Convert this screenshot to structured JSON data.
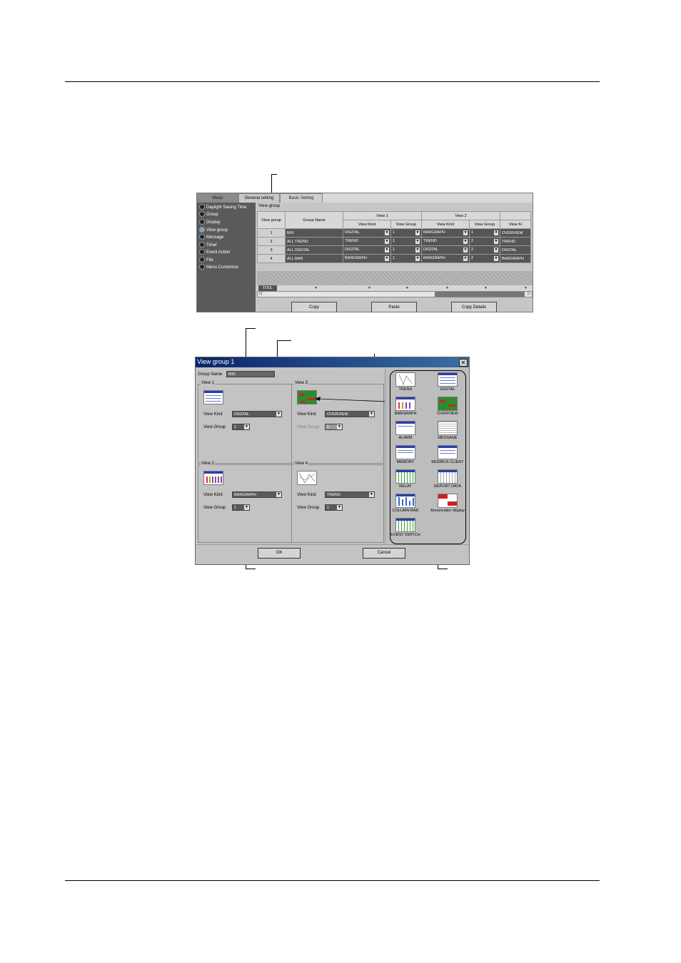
{
  "top_panel": {
    "tabs": [
      "Meas",
      "General setting",
      "Basic Setting"
    ],
    "side_items": [
      "Daylight Saving Time",
      "Group",
      "Display",
      "View group",
      "Message",
      "Timer",
      "Event Action",
      "File",
      "Menu Customize"
    ],
    "selected_side_item": "View group",
    "section_label": "View group",
    "headers": {
      "view_group": "View group",
      "group_name": "Group Name",
      "view1": "View 1",
      "view2": "View 2",
      "view_kind": "View Kind",
      "view_group_col": "View Group",
      "view_kind_cut": "View Ki"
    },
    "rows": [
      {
        "num": "1",
        "name": "MIX",
        "v1_kind": "DIGITAL",
        "v1_group": "1",
        "v2_kind": "BARGRAPH",
        "v2_group": "1",
        "v3_kind": "OVERVIEW"
      },
      {
        "num": "2",
        "name": "ALL TREND",
        "v1_kind": "TREND",
        "v1_group": "1",
        "v2_kind": "TREND",
        "v2_group": "2",
        "v3_kind": "TREND"
      },
      {
        "num": "3",
        "name": "ALL DIGITAL",
        "v1_kind": "DIGITAL",
        "v1_group": "1",
        "v2_kind": "DIGITAL",
        "v2_group": "2",
        "v3_kind": "DIGITAL"
      },
      {
        "num": "4",
        "name": "ALL BAR",
        "v1_kind": "BARGRAPH",
        "v1_group": "1",
        "v2_kind": "BARGRAPH",
        "v2_group": "2",
        "v3_kind": "BARGRAPH"
      }
    ],
    "tool_label": "TOOL",
    "buttons": {
      "copy": "Copy",
      "paste": "Paste",
      "copy_details": "Copy Details"
    }
  },
  "dialog": {
    "title": "View group 1",
    "group_name_label": "Group Name",
    "group_name_value": "MIX",
    "view_kind_label": "View Kind",
    "view_group_label": "View Group",
    "views": [
      {
        "title": "View 1",
        "kind": "DIGITAL",
        "group": "1"
      },
      {
        "title": "View 2",
        "kind": "BARGRAPH",
        "group": "1"
      },
      {
        "title": "View 3",
        "kind": "OVERVIEW",
        "group": "1"
      },
      {
        "title": "View 4",
        "kind": "TREND",
        "group": "1"
      }
    ],
    "palette": [
      "TREND",
      "DIGITAL",
      "BARGRAPH",
      "OVERVIEW",
      "ALARM",
      "MESSAGE",
      "MEMORY",
      "MODBUS CLIENT",
      "RELAY",
      "REPORT DATA",
      "COLUMN BAR",
      "Annunciator display",
      "EVENT SWITCH"
    ],
    "ok_label": "OK",
    "cancel_label": "Cancel"
  },
  "colors": {
    "title_bar": "#0a246a",
    "overview_green": "#2d8c2d",
    "trend_blue": "#2a3fa8"
  }
}
